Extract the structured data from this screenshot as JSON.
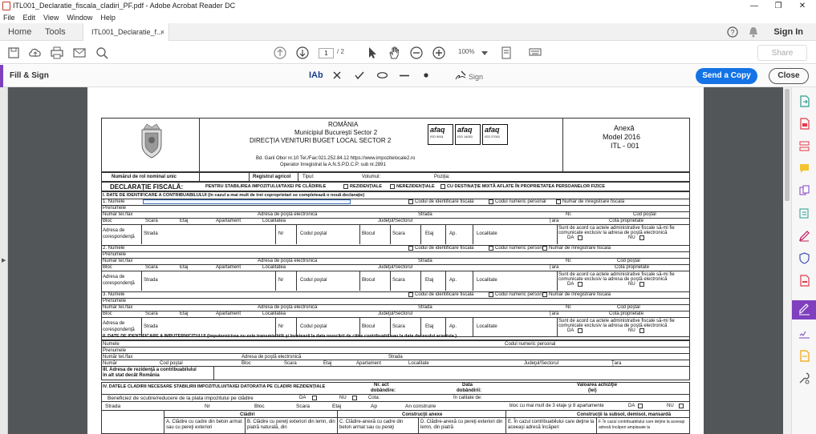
{
  "window": {
    "title": "ITL001_Declaratie_fiscala_cladiri_PF.pdf - Adobe Acrobat Reader DC",
    "minimize": "—",
    "restore": "❐",
    "close": "✕"
  },
  "menu": [
    "File",
    "Edit",
    "View",
    "Window",
    "Help"
  ],
  "tabs": {
    "home": "Home",
    "tools": "Tools",
    "doc_tab": "ITL001_Declaratie_f...",
    "doc_tab_close": "×",
    "sign_in": "Sign In"
  },
  "toolbar": {
    "page_current": "1",
    "page_total": "/ 2",
    "zoom": "100%",
    "share": "Share"
  },
  "fill_sign": {
    "label": "Fill & Sign",
    "text_tool": "IAb",
    "sign": "Sign",
    "send_copy": "Send a Copy",
    "close": "Close"
  },
  "form": {
    "header": {
      "country": "ROMÂNIA",
      "municipality": "Municipiul Bucureşti Sector 2",
      "direction": "DIRECŢIA VENITURI BUGET LOCAL SECTOR 2",
      "address": "Bd. Garii Obor nr.10 Tel./Fax:021.252.84.12  https://www.impozitelocale2.ro",
      "operator": "Operator înregistrat la A.N.S.P.D.C.P. sub nr.2891",
      "annex": "Anexă",
      "model": "Model 2016",
      "code": "ITL - 001",
      "cert_logo": "afaq",
      "cert_iso": [
        "ISO 9001",
        "ISO 14001",
        "ISO 27001"
      ]
    },
    "row_role": {
      "role_no": "Numărul de rol nominal unic",
      "registry": "Registrul agricol",
      "type": "Tipul:",
      "volume": "Volumul:",
      "position": "Poziţia:"
    },
    "declaration": {
      "title": "DECLARAŢIE FISCALĂ:",
      "purpose": "PENTRU STABILIREA IMPOZITULUI/TAXEI PE CLĂDIRILE",
      "residential": "REZIDENŢIALE",
      "nonresidential": "NEREZIDENŢIALE",
      "mixed": "CU DESTINAŢIE MIXTĂ  AFLATE ÎN PROPRIETATEA PERSOANELOR FIZICE"
    },
    "section1_title": "I. DATE DE IDENTIFICARE A CONTRIBUABILULUI (în cazul a mai mult de trei coproprietari se completează o nouă declaraţie)",
    "labels": {
      "name1": "1. Numele",
      "name2": "2. Numele",
      "name3": "3. Numele",
      "first_name": "Prenumele",
      "phone": "Număr tel./fax",
      "email": "Adresa de poştă electronică",
      "street": "Strada",
      "no": "Nr.",
      "postal": "Cod poştal",
      "postal_short": "Codul poştal",
      "block": "Bloc",
      "stair": "Scara",
      "floor": "Etaj",
      "apartment": "Apartament",
      "locality": "Localitatea",
      "county": "Judeţul/Sectorul",
      "country": "Ţara",
      "share": "Cotă proprietate",
      "corr_address": "Adresa de",
      "corr_address2": "corespondenţă",
      "nr": "Nr",
      "block_full": "Blocul",
      "ap": "Ap.",
      "loc": "Localitate",
      "fiscal_id": "Codul de identificare fiscală",
      "personal_code": "Codul numeric personal",
      "reg_no": "Număr de înregistrare fiscală",
      "consent1": "Sunt de acord ca actele administrative fiscale să-mi fie",
      "consent2": "comunicate exclusiv la adresa de poştă electronică",
      "yes": "DA",
      "no_opt": "NU"
    },
    "section2_title": "II. DATE DE IDENTIFICARE A IMPUTERNICITULUI  (împuternicirea nu este transmisibilă şi încetează la data revocării de către contribuabil sau la data decesului acestuia.)",
    "section2": {
      "last_name": "Numele",
      "first_name": "Prenumele",
      "phone": "Număr tel./fax",
      "email": "Adresa de poştă electronică",
      "cnp": "Codul numeric personal",
      "street": "Strada",
      "number": "Număr",
      "postal": "Cod poştal",
      "block": "Bloc",
      "stair": "Scara",
      "floor": "Etaj",
      "apartment": "Apartament",
      "locality": "Localitate",
      "county": "Judeţul/Sectorul",
      "country": "Ţara"
    },
    "section3_title": "III. Adresa de rezidenţă a contribuabilului",
    "section3_sub": "în alt stat decât România",
    "section4": {
      "title": "IV. DATELE CLADIRII NECESARE STABILIRII IMPOZITULUI/TAXEI DATORAT/A PE CLADIRI REZIDENŢIALE",
      "act_no": "Nr. act",
      "act_no2": "dobândire:",
      "date": "Data",
      "date2": "dobândirii:",
      "value": "Valoarea achiziţie",
      "value2": "(lei)",
      "benefit": "Beneficiez de scutire/reducere de la plata impozitului pe clădire",
      "yes": "DA",
      "no_opt": "NU",
      "quota": "Cota:",
      "quality": "În calitate de:",
      "street": "Strada",
      "nr": "Nr",
      "block": "Bloc",
      "stair": "Scara",
      "floor": "Etaj",
      "ap": "Ap",
      "year_built": "An construire",
      "floors_note": "bloc cu mai mult de 3 etaje şi 8 apartamente",
      "buildings": "Clădiri",
      "annexes": "Construcţii anexe",
      "underground": "Construcţii la subsol, demisol, mansardă",
      "col_a": "A. Clădire cu cadre din beton armat sau cu pereţi exteriori",
      "col_b": "B. Clădire cu pereţi exteriori din lemn, din piatră naturală, din",
      "col_c": "C. Clădire-anexă cu cadre din beton armat sau cu pereţi",
      "col_d": "D. Clădire-anexă cu pereţi exteriori din lemn, din piatră",
      "col_e": "E. În cazul contribuabilului care deţine la aceeaşi adresă încăperi",
      "col_f": "F. În cazul contribuabilului care deţine la aceeaşi adresă încăperi amplasate la"
    }
  }
}
